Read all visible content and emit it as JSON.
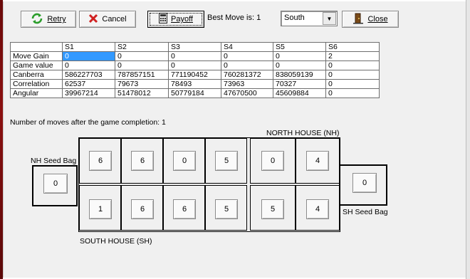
{
  "toolbar": {
    "retry": {
      "label": "Retry",
      "icon": "refresh-icon"
    },
    "cancel": {
      "label": "Cancel",
      "icon": "x-icon"
    },
    "payoff": {
      "label": "Payoff",
      "icon": "calculator-icon"
    },
    "best_move": "Best Move is: 1",
    "house_select": {
      "selected": "South"
    },
    "close": {
      "label": "Close",
      "icon": "door-icon"
    }
  },
  "table": {
    "headers": [
      "",
      "S1",
      "S2",
      "S3",
      "S4",
      "S5",
      "S6"
    ],
    "rows": [
      {
        "label": "Move Gain",
        "values": [
          "0",
          "0",
          "0",
          "0",
          "0",
          "2"
        ]
      },
      {
        "label": "Game value",
        "values": [
          "0",
          "0",
          "0",
          "0",
          "0",
          "0"
        ]
      },
      {
        "label": "Canberra",
        "values": [
          "586227703",
          "787857151",
          "771190452",
          "760281372",
          "838059139",
          "0"
        ]
      },
      {
        "label": "Correlation",
        "values": [
          "62537",
          "79673",
          "78493",
          "73963",
          "70327",
          "0"
        ]
      },
      {
        "label": "Angular",
        "values": [
          "39967214",
          "51478012",
          "50779184",
          "47670500",
          "45609884",
          "0"
        ]
      }
    ]
  },
  "moves_text": "Number of moves after the game completion: 1",
  "board": {
    "north_label": "NORTH HOUSE (NH)",
    "south_label": "SOUTH HOUSE (SH)",
    "nh_bag_label": "NH Seed Bag",
    "sh_bag_label": "SH Seed Bag",
    "nh_bag": "0",
    "sh_bag": "0",
    "north_pits": [
      "6",
      "6",
      "0",
      "5",
      "0",
      "4"
    ],
    "south_pits": [
      "1",
      "6",
      "6",
      "5",
      "5",
      "4"
    ]
  },
  "colors": {
    "selection": "#3399ff",
    "retry_icon": "#2a9d2a",
    "cancel_icon": "#d02020"
  }
}
